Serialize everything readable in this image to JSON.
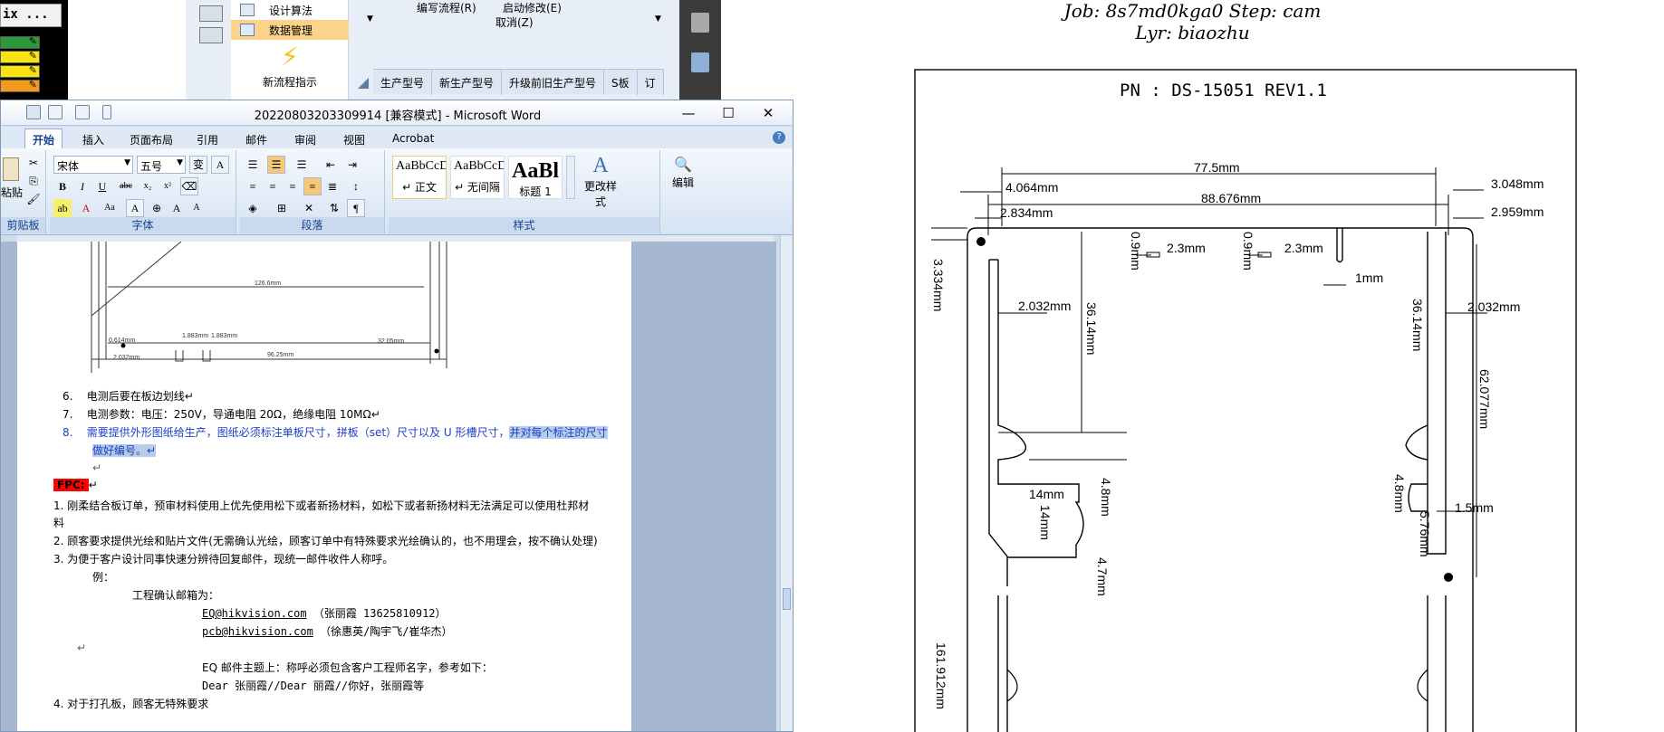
{
  "left_app": {
    "label": "ix ..."
  },
  "back_app": {
    "menu": [
      {
        "label": "设计算法",
        "selected": false
      },
      {
        "label": "数据管理",
        "selected": true
      }
    ],
    "new_flow_label": "新流程指示",
    "commands": [
      "编写流程(R)",
      "启动修改(E)",
      "取消(Z)"
    ],
    "grid_headers": [
      "生产型号",
      "新生产型号",
      "升级前旧生产型号",
      "S板",
      "订"
    ]
  },
  "viewer": {
    "title_job": "Job: 8s7md0kga0  Step: cam",
    "title_lyr": "Lyr: biaozhu"
  },
  "drawing": {
    "pn": "PN :   DS-15051 REV1.1",
    "dims": {
      "d77": "77.5mm",
      "d4064": "4.064mm",
      "d88": "88.676mm",
      "d3048": "3.048mm",
      "d2834": "2.834mm",
      "d2959": "2.959mm",
      "d09a": "0.9mm",
      "d09b": "0.9mm",
      "d23a": "2.3mm",
      "d23b": "2.3mm",
      "d1mm": "1mm",
      "d3334": "3.334mm",
      "d2032a": "2.032mm",
      "d3614a": "36.14mm",
      "d3614b": "36.14mm",
      "d2032b": "2.032mm",
      "d62": "62.077mm",
      "d48a": "4.8mm",
      "d48b": "4.8mm",
      "d14a": "14mm",
      "d14b": "14mm",
      "d15": "1.5mm",
      "d576": "5.76mm",
      "d47": "4.7mm",
      "d161": "161.912mm"
    }
  },
  "word": {
    "title": "20220803203309914 [兼容模式] - Microsoft Word",
    "tabs": [
      "开始",
      "插入",
      "页面布局",
      "引用",
      "邮件",
      "审阅",
      "视图",
      "Acrobat"
    ],
    "active_tab": "开始",
    "ribbon": {
      "font_name": "宋体",
      "font_size": "五号",
      "paste_label": "粘贴",
      "clipboard_label": "剪贴板",
      "font_group_label": "字体",
      "paragraph_group_label": "段落",
      "styles_group_label": "样式",
      "styles": [
        {
          "sample": "AaBbCcDc",
          "name": "↵ 正文"
        },
        {
          "sample": "AaBbCcDc",
          "name": "↵ 无间隔"
        },
        {
          "sample": "AaBl",
          "name": "标题 1"
        }
      ],
      "change_styles_label": "更改样式",
      "edit_label": "编辑"
    },
    "thumb_drawing": {
      "d1266": "126.6mm",
      "d614": "0.614mm",
      "d1883a": "1.883mm",
      "d1883b": "1.883mm",
      "d2032": "2.032mm",
      "d3205": "32.05mm",
      "d9625": "96.25mm"
    },
    "doc": {
      "item6": "电测后要在板边划线",
      "item7": "电测参数：电压：250V，导通电阻 20Ω，绝缘电阻 10MΩ",
      "item8_part1": "需要提供外形图纸给生产，图纸必须标注单板尺寸，拼板（set）尺寸以及 U 形槽尺寸，",
      "item8_part2": "并对每个标注的尺寸",
      "item8_part3": "做好编号。",
      "fpc_label": "FPC:",
      "p1_line1": "1.  刚柔结合板订单，预审材料使用上优先使用松下或者新扬材料，如松下或者新扬材料无法满足可以使用杜邦材",
      "p1_line2": "料",
      "p2": "2. 顾客要求提供光绘和贴片文件(无需确认光绘，顾客订单中有特殊要求光绘确认的，也不用理会，按不确认处理)",
      "p3": "3. 为便于客户设计同事快速分辨待回复邮件，现统一邮件收件人称呼。",
      "example": "例：",
      "eng_mailbox": "工程确认邮箱为：",
      "email1": "EQ@hikvision.com",
      "email1_note": "（张丽霞 13625810912）",
      "email2": "pcb@hikvision.com",
      "email2_note": "（徐惠英/陶宇飞/崔华杰）",
      "eq_subject": "EQ 邮件主题上：称呼必须包含客户工程师名字，参考如下：",
      "dear_line": "Dear  张丽霞//Dear  丽霞//你好，张丽霞等",
      "p4_partial": "4. 对于打孔板，顾客无特殊要求"
    }
  },
  "colors": {
    "word_blue_text": "#1c3ec8",
    "selection": "#b7cdea",
    "annotation_red": "#ff0000",
    "fpc_red": "#ff0000"
  }
}
